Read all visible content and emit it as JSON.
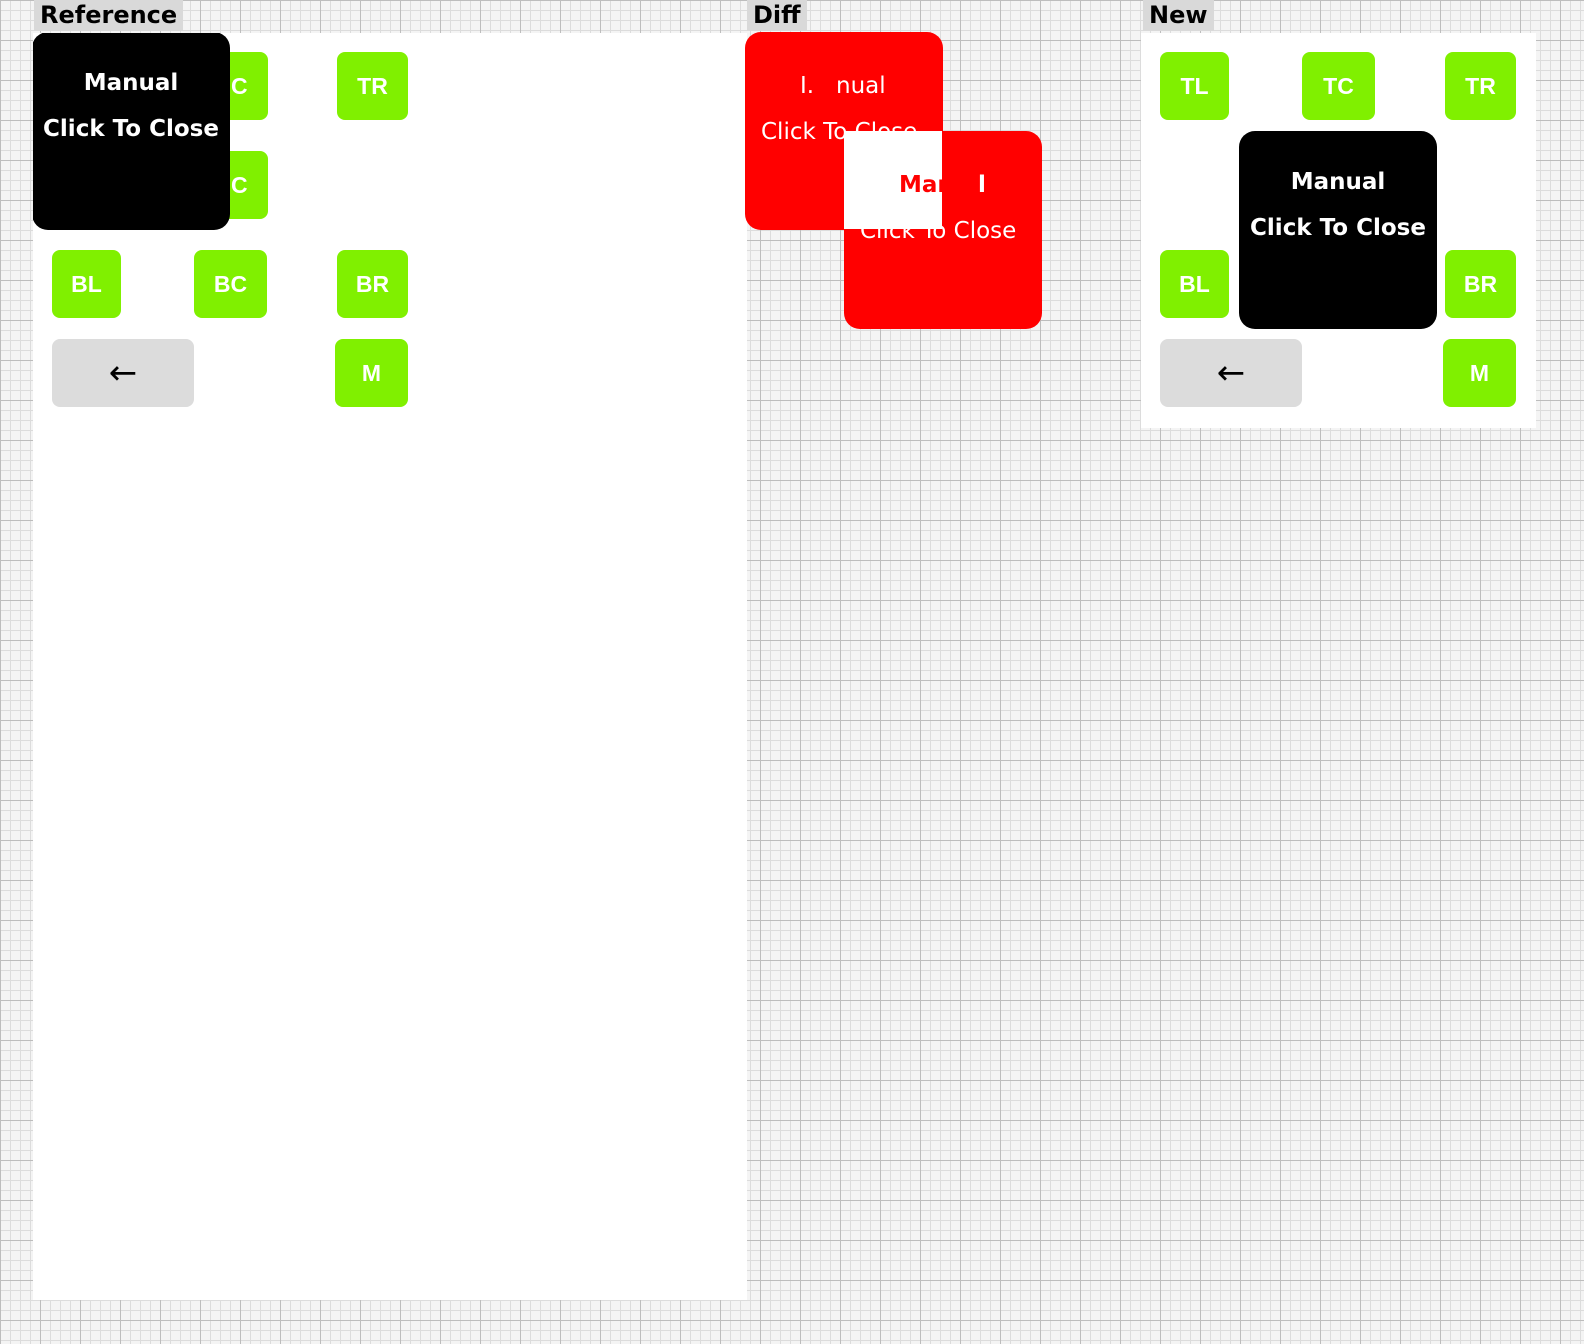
{
  "panels": {
    "reference_label": "Reference",
    "diff_label": "Diff",
    "new_label": "New"
  },
  "buttons": {
    "tl": "TL",
    "tc": "TC",
    "tr": "TR",
    "bl": "BL",
    "bc": "BC",
    "br": "BR",
    "m": "M",
    "back": "←",
    "ref_partial_top": "C",
    "ref_partial_mid": "C"
  },
  "popup": {
    "line1": "Manual",
    "line2": "Click To Close"
  },
  "diff": {
    "frag_a1": "I.",
    "frag_a2": "nual",
    "frag_a3": "Click To Close",
    "frag_b1": "Mar.",
    "frag_b2": "l",
    "frag_b3": "Click To Close"
  },
  "colors": {
    "button_green": "#80f000",
    "popup_black": "#000000",
    "diff_red": "#ff0000",
    "back_gray": "#dcdcdc"
  }
}
